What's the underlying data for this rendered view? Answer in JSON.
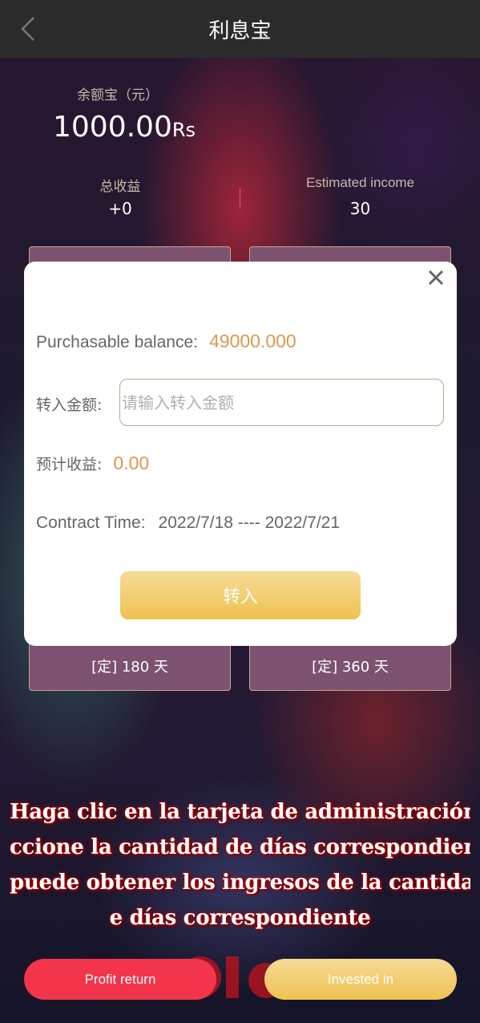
{
  "header": {
    "title": "利息宝",
    "back_icon": "chevron-left-icon"
  },
  "summary": {
    "balance_label": "余额宝（元）",
    "balance_value": "1000.00",
    "balance_unit": "Rs",
    "total_income_label": "总收益",
    "total_income_value": "+0",
    "estimated_income_label": "Estimated income",
    "estimated_income_value": "30"
  },
  "plans": {
    "plan_180": "[定] 180 天",
    "plan_360": "[定] 360 天"
  },
  "modal": {
    "close_icon": "close-icon",
    "purchasable_label": "Purchasable balance:",
    "purchasable_value": "49000.000",
    "amount_label": "转入金额:",
    "amount_placeholder": "请输入转入金额",
    "amount_value": "",
    "estimated_label": "预计收益:",
    "estimated_value": "0.00",
    "contract_label": "Contract Time:",
    "contract_value": "2022/7/18 ---- 2022/7/21",
    "submit_label": "转入"
  },
  "notice": {
    "lines": [
      "Haga clic en la tarjeta de administración d",
      "ccione la cantidad de días correspondiente",
      "puede obtener los ingresos de la cantidad d",
      "e días correspondiente"
    ]
  },
  "footer": {
    "profit_return_label": "Profit return",
    "invested_in_label": "Invested in"
  },
  "colors": {
    "accent_orange": "#e1984d",
    "gold_button": "#efc250",
    "red_button": "#f2354a",
    "plan_card": "#7c5270"
  }
}
